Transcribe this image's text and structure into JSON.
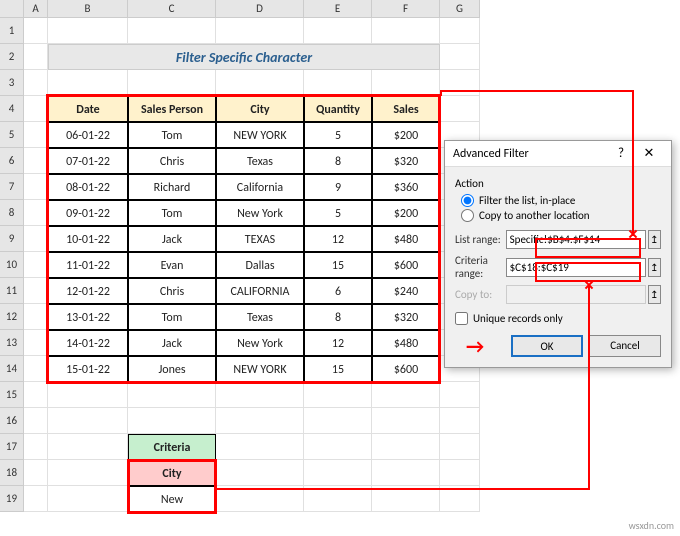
{
  "title": "Filter Specific Character",
  "columns": [
    "",
    "A",
    "B",
    "C",
    "D",
    "E",
    "F",
    "G"
  ],
  "rows": [
    "1",
    "2",
    "3",
    "4",
    "5",
    "6",
    "7",
    "8",
    "9",
    "10",
    "11",
    "12",
    "13",
    "14",
    "15",
    "16",
    "17",
    "18",
    "19"
  ],
  "table": {
    "headers": [
      "Date",
      "Sales Person",
      "City",
      "Quantity",
      "Sales"
    ],
    "data": [
      [
        "06-01-22",
        "Tom",
        "NEW YORK",
        "5",
        "$200"
      ],
      [
        "07-01-22",
        "Chris",
        "Texas",
        "8",
        "$320"
      ],
      [
        "08-01-22",
        "Richard",
        "California",
        "9",
        "$360"
      ],
      [
        "09-01-22",
        "Tom",
        "New York",
        "5",
        "$200"
      ],
      [
        "10-01-22",
        "Jack",
        "TEXAS",
        "12",
        "$480"
      ],
      [
        "11-01-22",
        "Evan",
        "Dallas",
        "15",
        "$600"
      ],
      [
        "12-01-22",
        "Chris",
        "CALIFORNIA",
        "6",
        "$240"
      ],
      [
        "13-01-22",
        "Tom",
        "Texas",
        "8",
        "$320"
      ],
      [
        "14-01-22",
        "Jack",
        "New York",
        "12",
        "$480"
      ],
      [
        "15-01-22",
        "Jones",
        "NEW YORK",
        "15",
        "$600"
      ]
    ]
  },
  "criteria": {
    "title": "Criteria",
    "header": "City",
    "value": "New"
  },
  "dialog": {
    "title": "Advanced Filter",
    "action_label": "Action",
    "radio1": "Filter the list, in-place",
    "radio2": "Copy to another location",
    "list_range_label": "List range:",
    "list_range_value": "Specific!$B$4:$F$14",
    "criteria_range_label": "Criteria range:",
    "criteria_range_value": "$C$18:$C$19",
    "copy_to_label": "Copy to:",
    "unique_label": "Unique records only",
    "ok": "OK",
    "cancel": "Cancel"
  },
  "watermark": "wsxdn.com"
}
